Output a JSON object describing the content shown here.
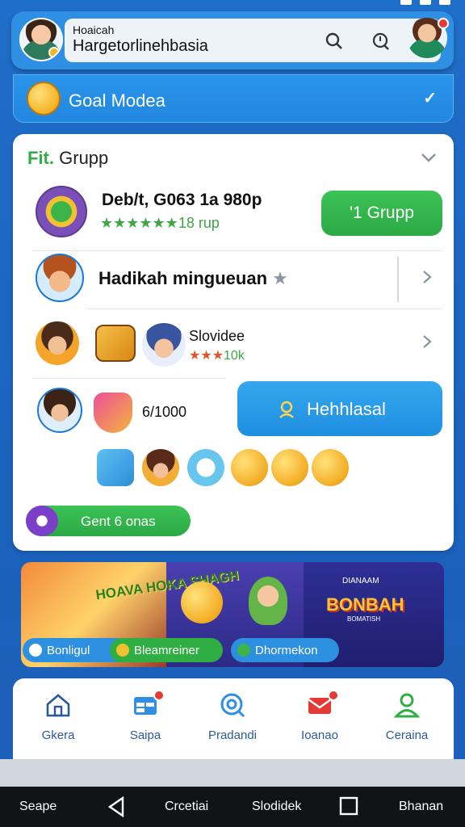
{
  "header": {
    "search_small": "Hoaicah",
    "search_big": "Hargetorlinehbasia"
  },
  "goal": {
    "label": "Goal Modea",
    "check": "✓"
  },
  "group_card": {
    "title_accent": "Fit.",
    "title": "Grupp",
    "row1": {
      "title": "Deb/t, G063 1a 980p",
      "stars": "★★★★★★",
      "rating": "18 rup",
      "button": "'1 Grupp"
    },
    "row2": {
      "title": "Hadikah mingueuan",
      "star": "★"
    },
    "row3": {
      "title": "Slovidee",
      "stars": "★★★",
      "rating": "10k"
    },
    "row4": {
      "count": "6/1000",
      "button": "Hehhlasal"
    },
    "pill_button": "Gent 6 onas"
  },
  "promo": {
    "panel1_text": "HOAVA HOKA SHAGH",
    "panel3_small": "DIANAAM",
    "panel3_text": "BONBAH",
    "panel3_small2": "BOMATISH",
    "chips": [
      "Bonligul",
      "Bleamreiner",
      "Dhormekon"
    ]
  },
  "bottom_nav": {
    "items": [
      {
        "label": "Gkera",
        "icon": "home-icon",
        "badge": false
      },
      {
        "label": "Saipa",
        "icon": "calendar-icon",
        "badge": true
      },
      {
        "label": "Pradandi",
        "icon": "search-icon",
        "badge": false
      },
      {
        "label": "Ioanao",
        "icon": "mail-icon",
        "badge": true
      },
      {
        "label": "Ceraina",
        "icon": "profile-icon",
        "badge": false
      }
    ]
  },
  "system_bar": {
    "left": "Seape",
    "mid1": "Crcetiai",
    "mid2": "Slodidek",
    "right": "Bhanan"
  },
  "colors": {
    "primary_blue": "#2f8fe3",
    "green": "#2fae44",
    "background": "#1f6ec9"
  }
}
